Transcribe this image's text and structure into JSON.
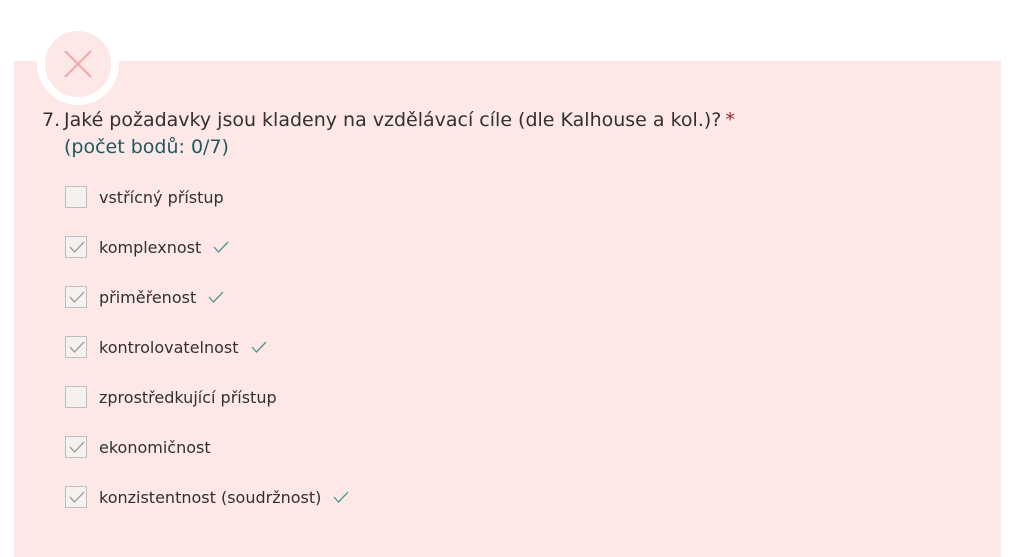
{
  "question": {
    "number": "7.",
    "text": "Jaké požadavky jsou kladeny na vzdělávací cíle (dle Kalhouse a kol.)?",
    "required_mark": "*",
    "points": "(počet bodů: 0/7)",
    "status": "incorrect",
    "colors": {
      "card_background": "#fde7e7",
      "incorrect_icon": "#f4a7aa",
      "correct_check": "#4a9a8f",
      "points_text": "#1f5a5e",
      "required": "#a4262c"
    }
  },
  "options": [
    {
      "label": "vstřícný přístup",
      "checked": false,
      "marked_correct": false
    },
    {
      "label": "komplexnost",
      "checked": true,
      "marked_correct": true
    },
    {
      "label": "přiměřenost",
      "checked": true,
      "marked_correct": true
    },
    {
      "label": "kontrolovatelnost",
      "checked": true,
      "marked_correct": true
    },
    {
      "label": "zprostředkující přístup",
      "checked": false,
      "marked_correct": false
    },
    {
      "label": "ekonomičnost",
      "checked": true,
      "marked_correct": false
    },
    {
      "label": "konzistentnost (soudržnost)",
      "checked": true,
      "marked_correct": true
    }
  ]
}
